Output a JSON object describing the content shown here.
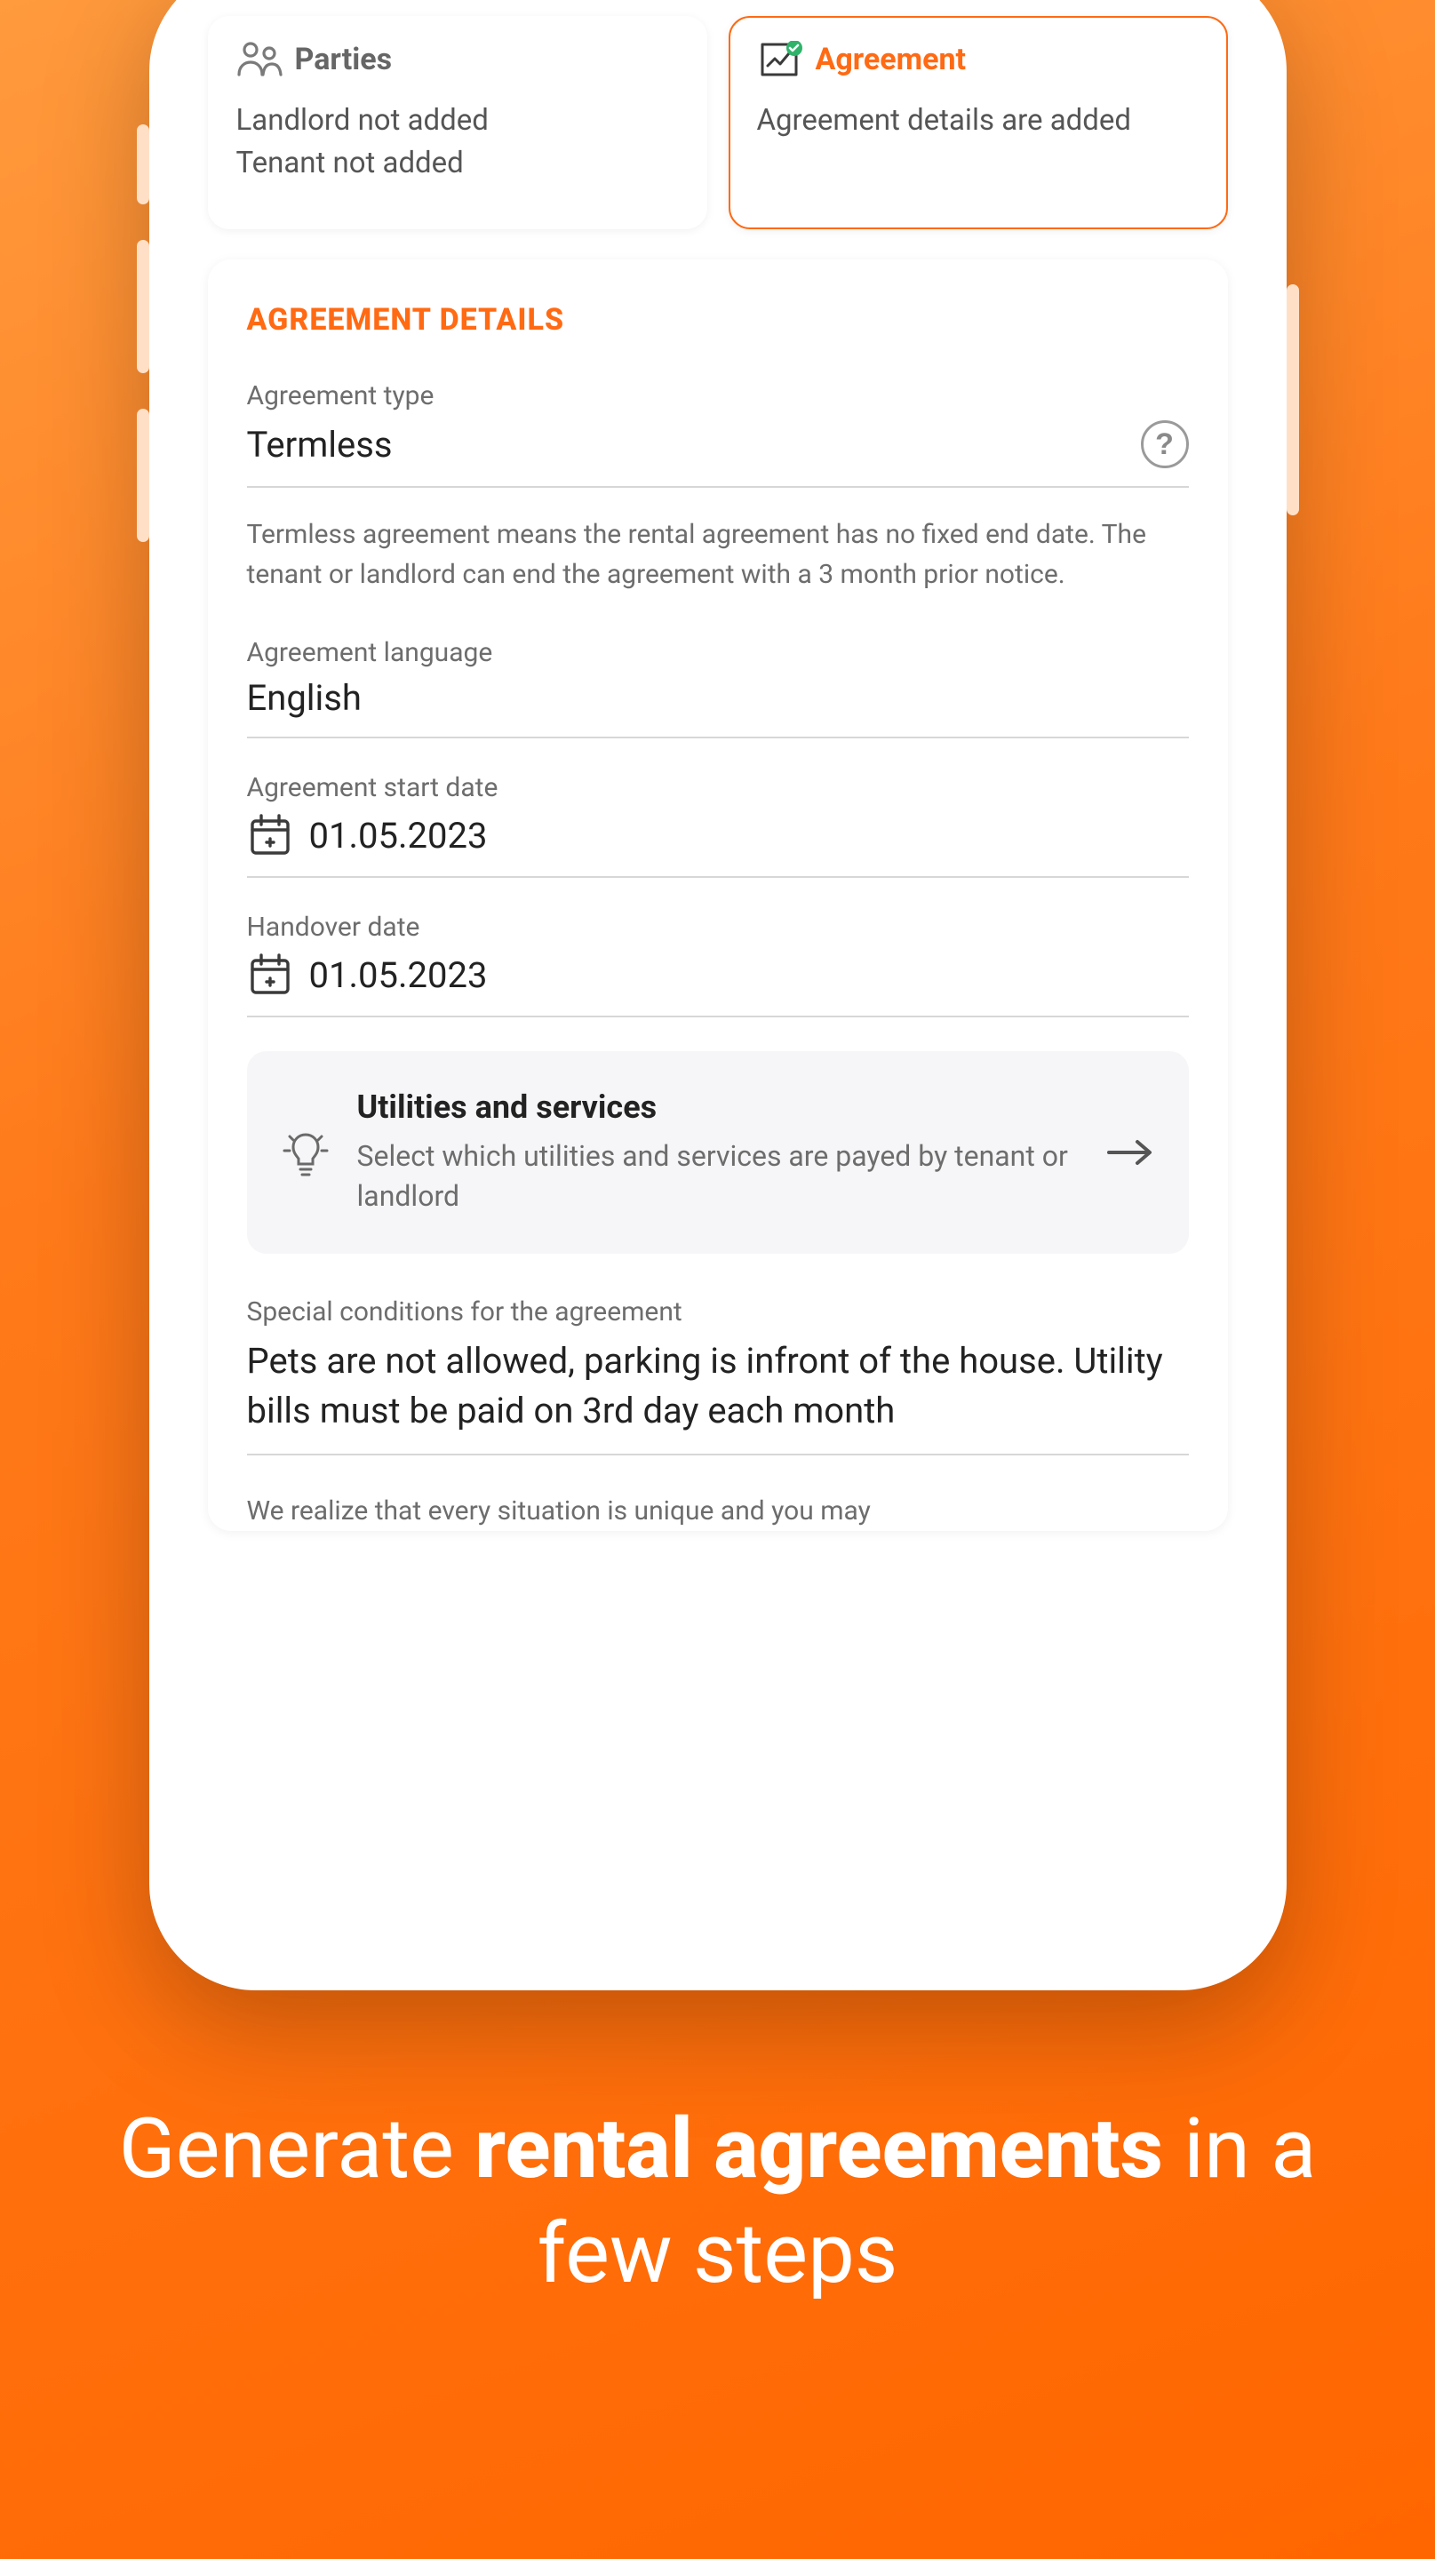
{
  "tabs": {
    "parties": {
      "title": "Parties",
      "line1": "Landlord not added",
      "line2": "Tenant not added",
      "active": false
    },
    "agreement": {
      "title": "Agreement",
      "body": "Agreement details are added",
      "active": true
    }
  },
  "details": {
    "title": "AGREEMENT DETAILS",
    "type": {
      "label": "Agreement type",
      "value": "Termless",
      "explainer": "Termless agreement means the rental agreement has no fixed end date. The tenant or landlord can end the agreement with a 3 month prior notice."
    },
    "language": {
      "label": "Agreement language",
      "value": "English"
    },
    "start_date": {
      "label": "Agreement start date",
      "value": "01.05.2023"
    },
    "handover_date": {
      "label": "Handover date",
      "value": "01.05.2023"
    },
    "utilities": {
      "title": "Utilities and services",
      "desc": "Select which utilities and services are payed by tenant or landlord"
    },
    "special": {
      "label": "Special conditions for the agreement",
      "value": "Pets are not allowed, parking is infront of the house. Utility bills must be paid on 3rd day each month"
    },
    "footnote": "We realize that every situation is unique and you may"
  },
  "marketing": {
    "pre": "Generate ",
    "bold": "rental agreements",
    "post": " in a few steps"
  },
  "glyphs": {
    "question": "?"
  }
}
